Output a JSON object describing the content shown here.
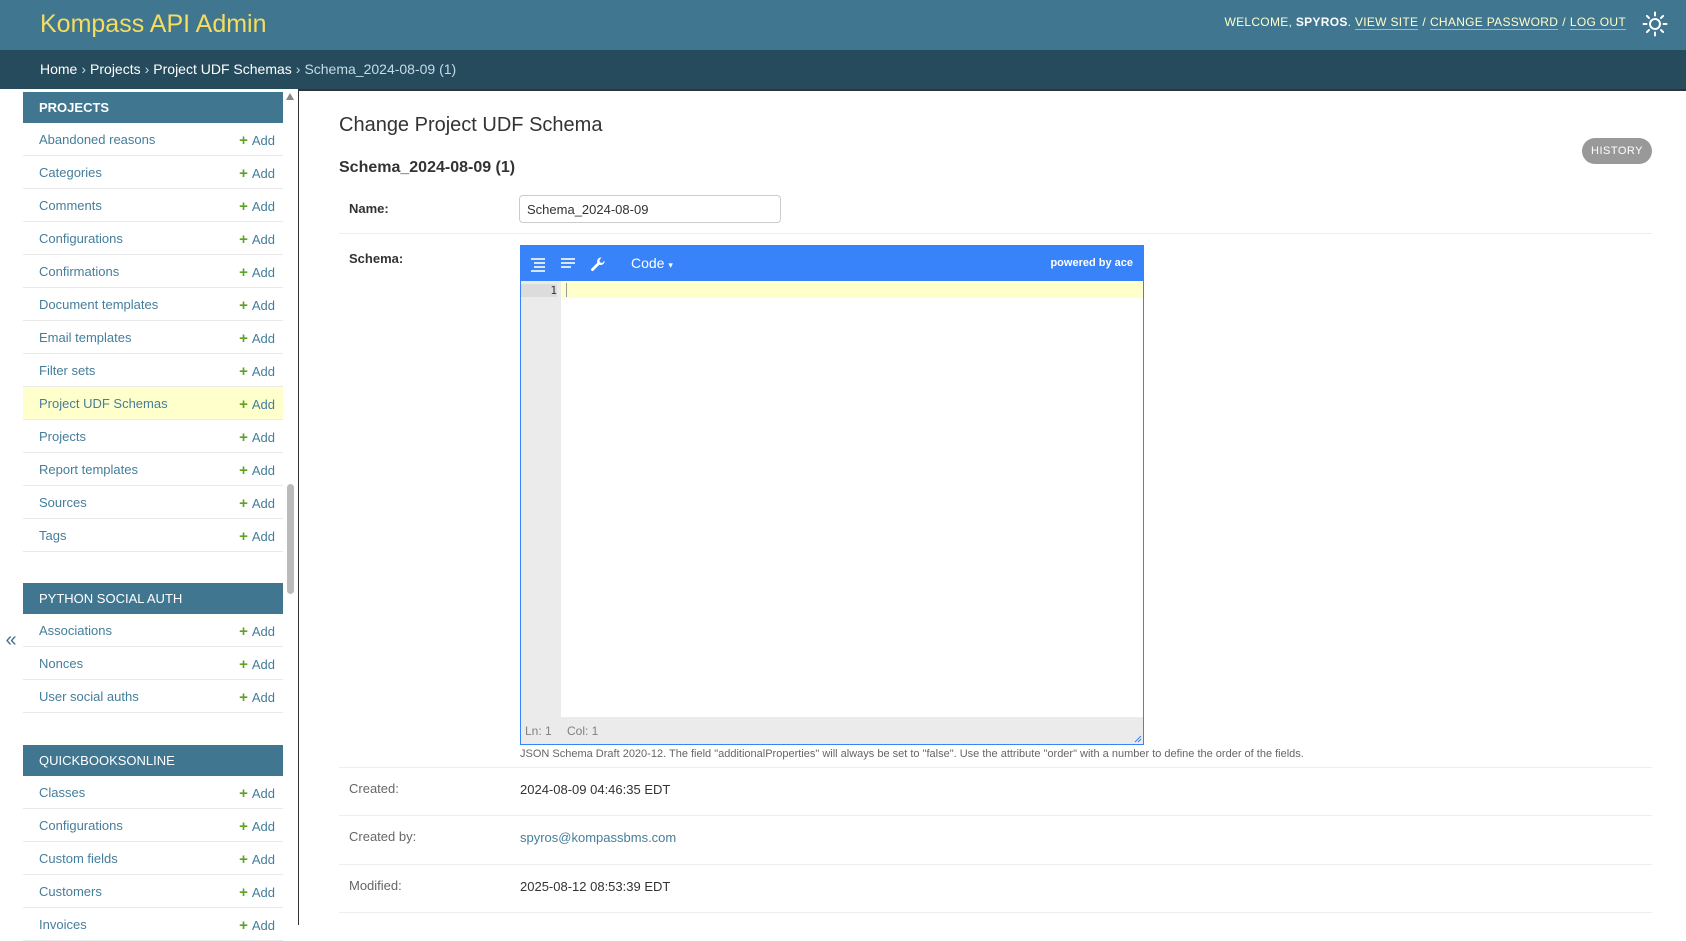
{
  "header": {
    "brand": "Kompass API Admin",
    "welcome": "Welcome,",
    "username": "Spyros",
    "view_site": "View site",
    "change_password": "Change password",
    "log_out": "Log out",
    "sep": "/"
  },
  "breadcrumbs": {
    "home": "Home",
    "projects": "Projects",
    "schemas": "Project UDF Schemas",
    "current": "Schema_2024-08-09 (1)",
    "sep": "›"
  },
  "sidebar": {
    "toggle": "«",
    "add_label": "Add",
    "apps": [
      {
        "caption": "Projects",
        "models": [
          "Abandoned reasons",
          "Categories",
          "Comments",
          "Configurations",
          "Confirmations",
          "Document templates",
          "Email templates",
          "Filter sets",
          "Project UDF Schemas",
          "Projects",
          "Report templates",
          "Sources",
          "Tags"
        ]
      },
      {
        "caption": "Python Social Auth",
        "models": [
          "Associations",
          "Nonces",
          "User social auths"
        ]
      },
      {
        "caption": "Quickbooksonline",
        "models": [
          "Classes",
          "Configurations",
          "Custom fields",
          "Customers",
          "Invoices"
        ]
      }
    ]
  },
  "main": {
    "title": "Change Project UDF Schema",
    "history": "History",
    "subtitle": "Schema_2024-08-09 (1)",
    "name_label": "Name:",
    "name_value": "Schema_2024-08-09",
    "schema_label": "Schema:",
    "editor": {
      "mode": "Code",
      "mode_caret": "▾",
      "powered": "powered by ace",
      "line_number": "1",
      "ln": "Ln: 1",
      "col": "Col: 1"
    },
    "help": "JSON Schema Draft 2020-12. The field \"additionalProperties\" will always be set to \"false\". Use the attribute \"order\" with a number to define the order of the fields.",
    "created_label": "Created:",
    "created_value": "2024-08-09 04:46:35 EDT",
    "created_by_label": "Created by:",
    "created_by_value": "spyros@kompassbms.com",
    "modified_label": "Modified:",
    "modified_value": "2025-08-12 08:53:39 EDT"
  }
}
